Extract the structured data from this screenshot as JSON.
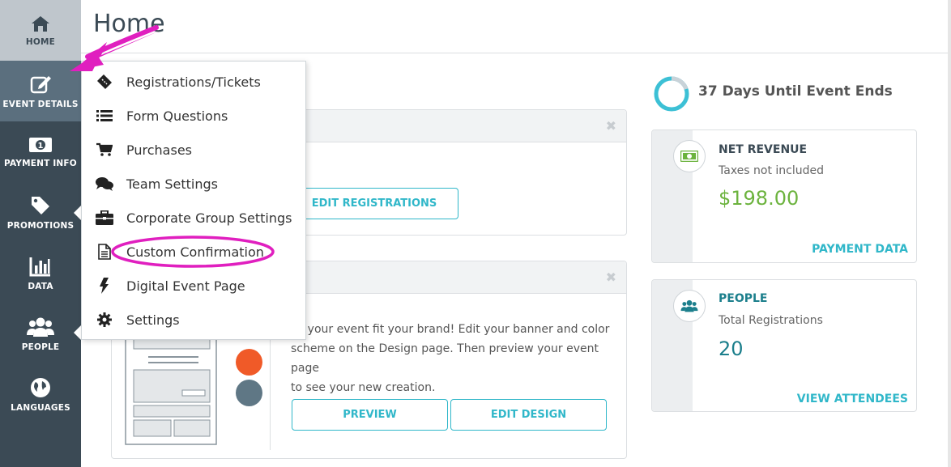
{
  "sidebar": {
    "items": [
      {
        "label": "HOME",
        "icon": "home-icon"
      },
      {
        "label": "EVENT DETAILS",
        "icon": "edit-icon"
      },
      {
        "label": "PAYMENT INFO",
        "icon": "money-icon"
      },
      {
        "label": "PROMOTIONS",
        "icon": "tag-icon"
      },
      {
        "label": "DATA",
        "icon": "bar-chart-icon"
      },
      {
        "label": "PEOPLE",
        "icon": "users-icon"
      },
      {
        "label": "LANGUAGES",
        "icon": "globe-icon"
      }
    ]
  },
  "header": {
    "title": "Home"
  },
  "menu": {
    "items": [
      {
        "label": "Registrations/Tickets",
        "icon": "ticket-icon"
      },
      {
        "label": "Form Questions",
        "icon": "list-icon"
      },
      {
        "label": "Purchases",
        "icon": "cart-icon"
      },
      {
        "label": "Team Settings",
        "icon": "comments-icon"
      },
      {
        "label": "Corporate Group Settings",
        "icon": "briefcase-icon"
      },
      {
        "label": "Custom Confirmation",
        "icon": "document-icon"
      },
      {
        "label": "Digital Event Page",
        "icon": "bolt-icon"
      },
      {
        "label": "Settings",
        "icon": "gear-icon"
      }
    ]
  },
  "registrations_card": {
    "button_label": "EDIT REGISTRATIONS"
  },
  "design_card": {
    "description_lines": [
      "ke your event fit your brand! Edit your banner and color",
      "scheme on the Design page. Then preview your event page",
      "to see your new creation."
    ],
    "preview_label": "PREVIEW",
    "edit_design_label": "EDIT DESIGN",
    "swatch_colors": [
      "#f05a28",
      "#5f7785"
    ]
  },
  "countdown": {
    "text": "37 Days Until Event Ends",
    "progress": 0.2
  },
  "revenue": {
    "title": "NET REVENUE",
    "subtitle": "Taxes not included",
    "value": "$198.00",
    "link": "PAYMENT DATA"
  },
  "people": {
    "title": "PEOPLE",
    "subtitle": "Total Registrations",
    "value": "20",
    "link": "VIEW ATTENDEES"
  },
  "colors": {
    "accent": "#30b7c9",
    "sidebar": "#3b4a55",
    "annotation": "#e01fbf",
    "revenue_green": "#6cb33e",
    "people_teal": "#1c7f8c"
  }
}
